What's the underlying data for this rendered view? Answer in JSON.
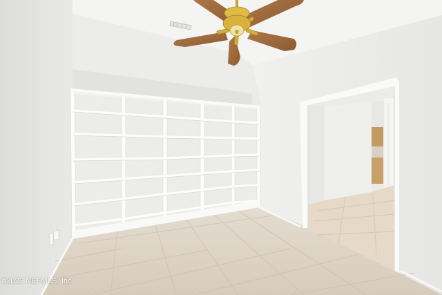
{
  "photo": {
    "subject": "Empty room with built-in white bookshelves, ceiling fan and tiled floor",
    "watermark": "©2025 NEFMLS, Inc"
  },
  "colors": {
    "wall": "#ebebe9",
    "ceiling": "#f3f3f2",
    "shelf": "#fbfbfa",
    "floor_tile": "#ddd3c6",
    "grout": "#cfc5b6",
    "fan_blade": "#9c6a40",
    "fan_brass": "#d9b340"
  },
  "shelving": {
    "columns": 5,
    "rows": 7
  }
}
